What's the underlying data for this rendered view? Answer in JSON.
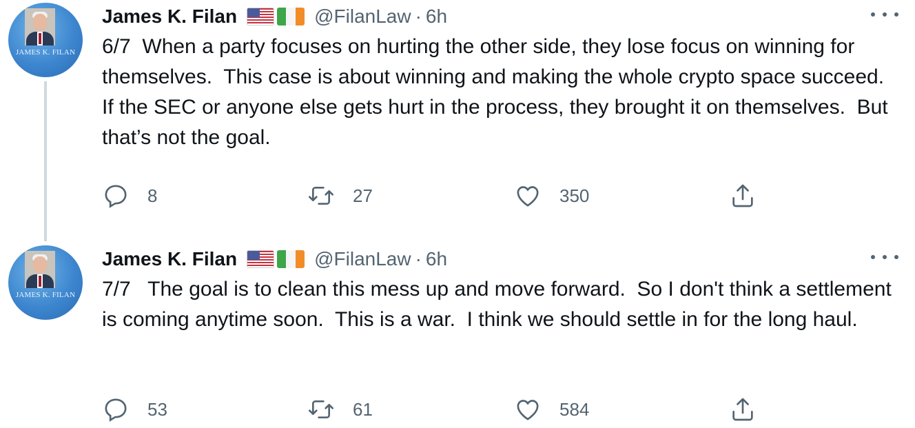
{
  "tweets": [
    {
      "author": {
        "name": "James K. Filan",
        "handle": "@FilanLaw",
        "avatar_text": "JAMES K. FILAN",
        "flags": [
          "us-flag-icon",
          "ireland-flag-icon"
        ]
      },
      "separator": "·",
      "time": "6h",
      "text": "6/7  When a party focuses on hurting the other side, they lose focus on winning for themselves.  This case is about winning and making the whole crypto space succeed.  If the SEC or anyone else gets hurt in the process, they brought it on themselves.  But that’s not the goal.",
      "stats": {
        "replies": "8",
        "retweets": "27",
        "likes": "350"
      }
    },
    {
      "author": {
        "name": "James K. Filan",
        "handle": "@FilanLaw",
        "avatar_text": "JAMES K. FILAN",
        "flags": [
          "us-flag-icon",
          "ireland-flag-icon"
        ]
      },
      "separator": "·",
      "time": "6h",
      "text": "7/7   The goal is to clean this mess up and move forward.  So I don't think a settlement is coming anytime soon.  This is a war.  I think we should settle in for the long haul.",
      "stats": {
        "replies": "53",
        "retweets": "61",
        "likes": "584"
      }
    }
  ],
  "colors": {
    "text_primary": "#0f1419",
    "text_secondary": "#536471",
    "thread_line": "#cfd9de",
    "avatar_blue": "#3d86cf"
  }
}
